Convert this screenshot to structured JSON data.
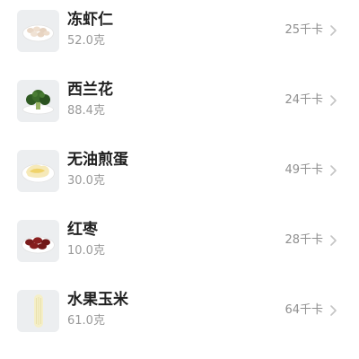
{
  "colors": {
    "name_text": "#1f1f1f",
    "secondary_text": "#9a9a9a",
    "chevron": "#c4c4c4",
    "thumb_bg": "#eeeff1"
  },
  "food_items": [
    {
      "name": "冻虾仁",
      "weight": "52.0克",
      "calories": "25千卡",
      "icon": "shrimp-icon"
    },
    {
      "name": "西兰花",
      "weight": "88.4克",
      "calories": "24千卡",
      "icon": "broccoli-icon"
    },
    {
      "name": "无油煎蛋",
      "weight": "30.0克",
      "calories": "49千卡",
      "icon": "fried-egg-icon"
    },
    {
      "name": "红枣",
      "weight": "10.0克",
      "calories": "28千卡",
      "icon": "red-dates-icon"
    },
    {
      "name": "水果玉米",
      "weight": "61.0克",
      "calories": "64千卡",
      "icon": "corn-icon"
    }
  ]
}
